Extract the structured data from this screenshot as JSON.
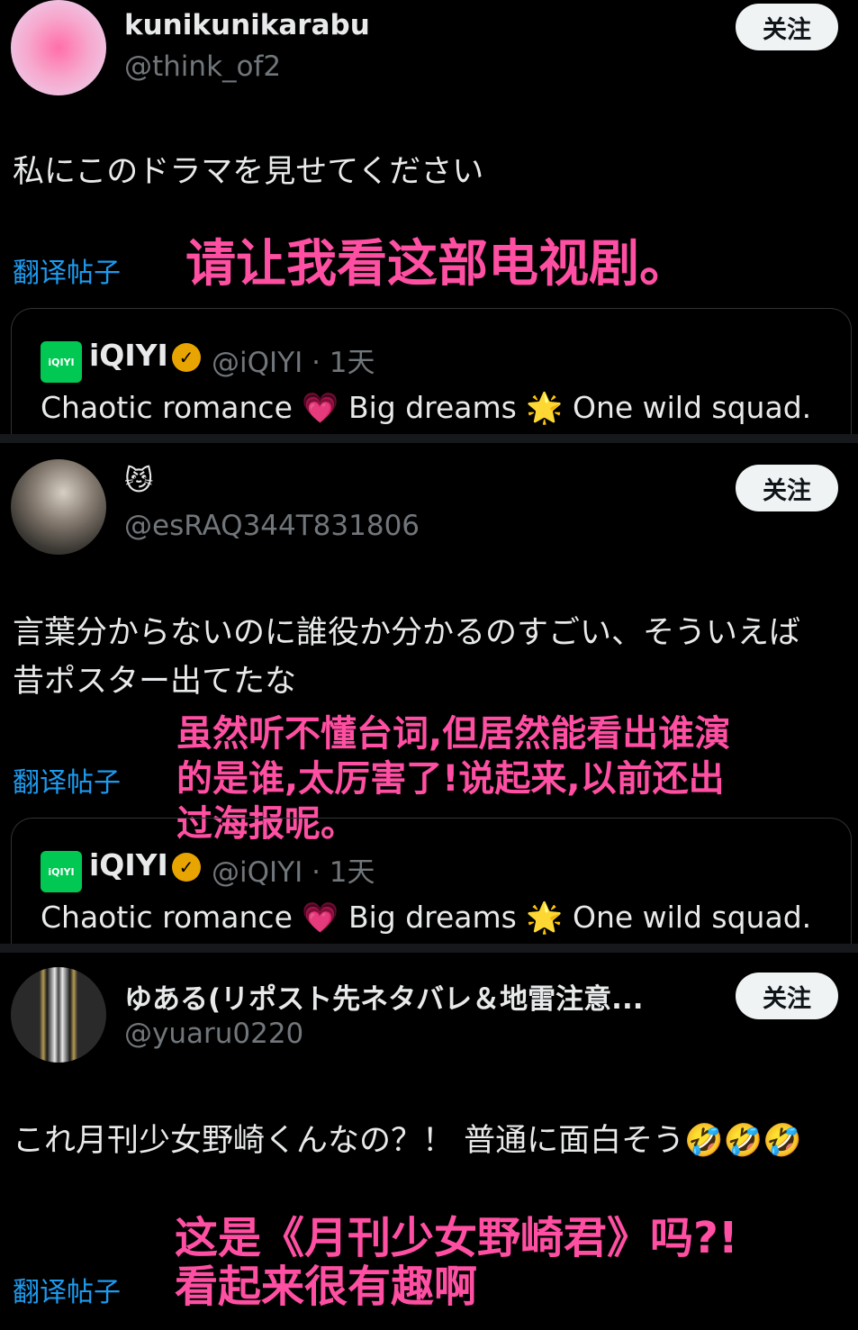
{
  "posts": [
    {
      "name": "kunikunikarabu",
      "handle": "@think_of2",
      "follow": "关注",
      "text": "私にこのドラマを見せてください",
      "translate": "翻译帖子",
      "overlay": "请让我看这部电视剧。",
      "quote": {
        "logo": "iQIYI",
        "name": "iQIYI",
        "handle": "@iQIYI · 1天",
        "text_1": "Chaotic romance",
        "emoji_1": "💗",
        "text_2": "Big dreams",
        "emoji_2": "🌟",
        "text_3": "One wild squad."
      }
    },
    {
      "name": "😼",
      "handle": "@esRAQ344T831806",
      "follow": "关注",
      "text": "言葉分からないのに誰役か分かるのすごい、そういえば昔ポスター出てたな",
      "translate": "翻译帖子",
      "overlay_1": "虽然听不懂台词,但居然能看出谁演",
      "overlay_2": "的是谁,太厉害了!说起来,以前还出",
      "overlay_3": "过海报呢。",
      "quote": {
        "logo": "iQIYI",
        "name": "iQIYI",
        "handle": "@iQIYI · 1天",
        "text_1": "Chaotic romance",
        "emoji_1": "💗",
        "text_2": "Big dreams",
        "emoji_2": "🌟",
        "text_3": "One wild squad."
      }
    },
    {
      "name": "ゆある(リポスト先ネタバレ＆地雷注意...",
      "handle": "@yuaru0220",
      "follow": "关注",
      "text": "これ月刊少女野崎くんなの？！ 普通に面白そう🤣🤣🤣",
      "translate": "翻译帖子",
      "overlay_1": "这是《月刊少女野崎君》吗?!",
      "overlay_2": "看起来很有趣啊"
    }
  ],
  "colors": {
    "accent": "#1d9bf0",
    "overlay": "#ff4fa3",
    "follow_bg": "#eff3f4",
    "brand_green": "#00c853",
    "verified": "#e8a400"
  }
}
